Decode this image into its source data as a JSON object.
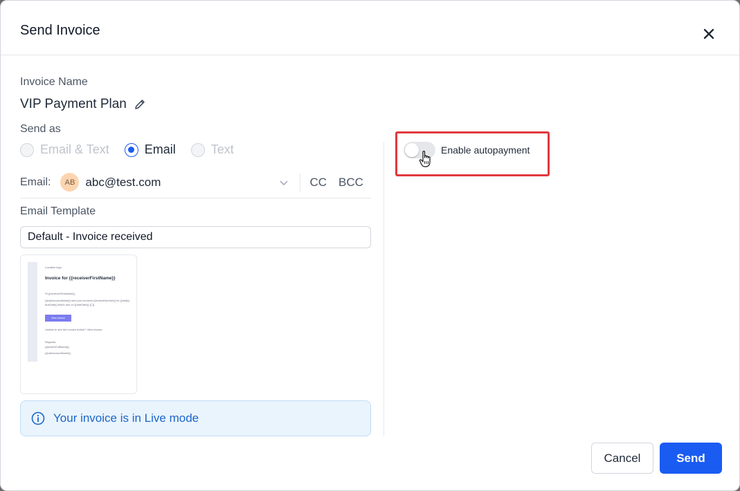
{
  "modal": {
    "title": "Send Invoice"
  },
  "invoice_name": {
    "label": "Invoice Name",
    "value": "VIP Payment Plan"
  },
  "send_as": {
    "label": "Send as",
    "options": [
      {
        "label": "Email & Text",
        "state": "disabled"
      },
      {
        "label": "Email",
        "state": "selected"
      },
      {
        "label": "Text",
        "state": "disabled"
      }
    ]
  },
  "email": {
    "label": "Email:",
    "avatar_initials": "AB",
    "value": "abc@test.com",
    "cc_label": "CC",
    "bcc_label": "BCC"
  },
  "template": {
    "label": "Email Template",
    "selected": "Default - Invoice received",
    "preview": {
      "logo_alt": "Location logo",
      "heading": "Invoice for {{receiverFirstName}}",
      "greeting": "Hi {{receiverFirstName}},",
      "body_line1": "{{subAccountName}} sent you invoice# {{invoiceNumber}} for {{total}}",
      "body_line2": "dueDate}} that's due on {{dueDate}} {{\"}}",
      "button": "View Invoice",
      "unable_text": "Unable to see the invoice button? View invoice",
      "regards": "Regards,",
      "sender": "{{senderFullName}}",
      "subaccount": "{{subAccountName}}"
    }
  },
  "info": {
    "text": "Your invoice is in Live mode"
  },
  "autopayment": {
    "label": "Enable autopayment",
    "enabled": false
  },
  "actions": {
    "cancel_label": "Cancel",
    "send_label": "Send"
  },
  "colors": {
    "primary": "#1a5cf2",
    "highlight": "#e0383e",
    "info_bg": "#eaf4fd"
  },
  "icons": {
    "close": "close-icon",
    "edit": "pencil-icon",
    "chevron": "chevron-down-icon",
    "info": "info-icon",
    "cursor": "hand-pointer-icon"
  }
}
